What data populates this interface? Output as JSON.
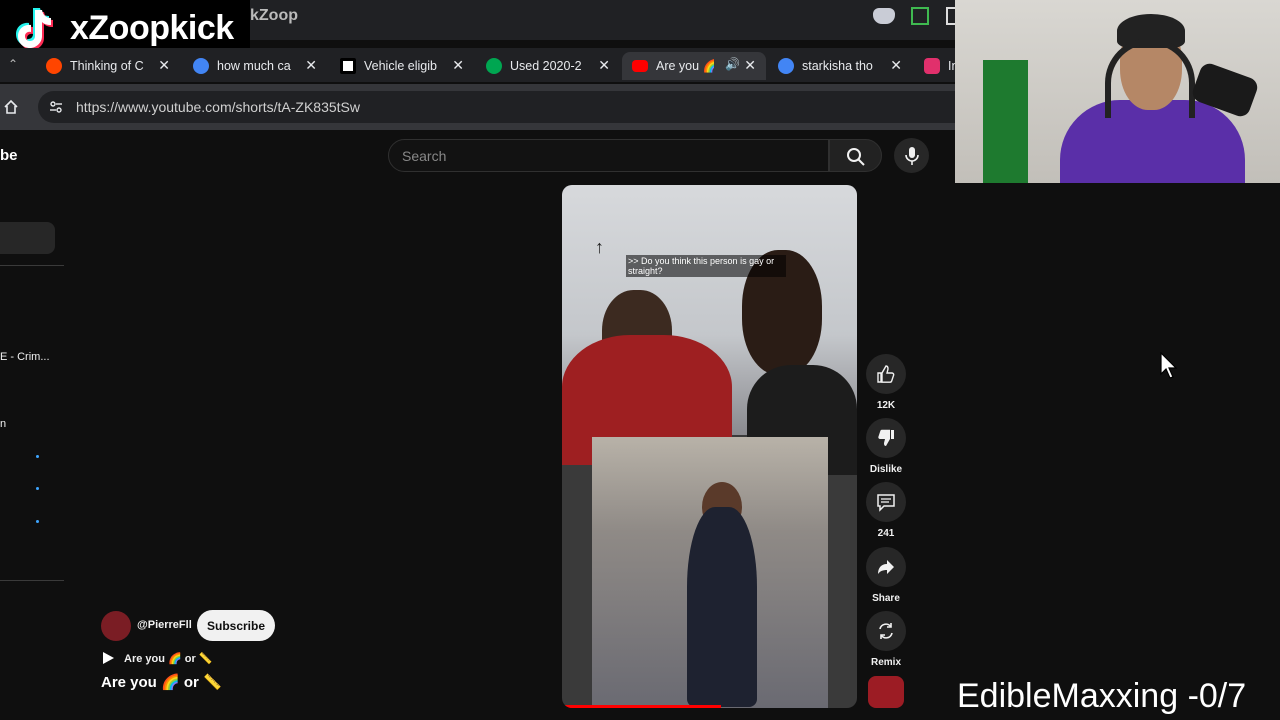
{
  "window": {
    "title_partial": "kZoop"
  },
  "streamer": {
    "brand": "xZoopkick"
  },
  "tabs": [
    {
      "label": "Thinking of C",
      "favicon_color": "#ff4500",
      "active": false
    },
    {
      "label": "how much ca",
      "favicon_color": "#4285f4",
      "active": false
    },
    {
      "label": "Vehicle eligib",
      "favicon_color": "#000000",
      "active": false
    },
    {
      "label": "Used 2020-2",
      "favicon_color": "#00a651",
      "active": false
    },
    {
      "label": "Are you 🌈",
      "favicon_color": "#ff0000",
      "active": true
    },
    {
      "label": "starkisha tho",
      "favicon_color": "#4285f4",
      "active": false
    },
    {
      "label": "In",
      "favicon_color": "#e1306c",
      "active": false
    }
  ],
  "address_bar": {
    "url": "https://www.youtube.com/shorts/tA-ZK835tSw"
  },
  "youtube": {
    "logo_fragment": "be",
    "search_placeholder": "Search",
    "sidebar_text": "E - Crim...",
    "sidebar_char": "n"
  },
  "short": {
    "caption": ">> Do you think this person is gay or straight?",
    "likes": "12K",
    "dislike_label": "Dislike",
    "comments": "241",
    "share_label": "Share",
    "remix_label": "Remix",
    "channel": "@PierreFll",
    "subscribe_label": "Subscribe",
    "mini_title": "Are you 🌈 or 📏",
    "title": "Are you 🌈 or 📏",
    "progress": 0.54
  },
  "overlay_text": "EdibleMaxxing -0/7",
  "colors": {
    "accent_red": "#ff0000",
    "subscribe_bg": "#f1f1f1",
    "bg": "#0f0f0f"
  }
}
